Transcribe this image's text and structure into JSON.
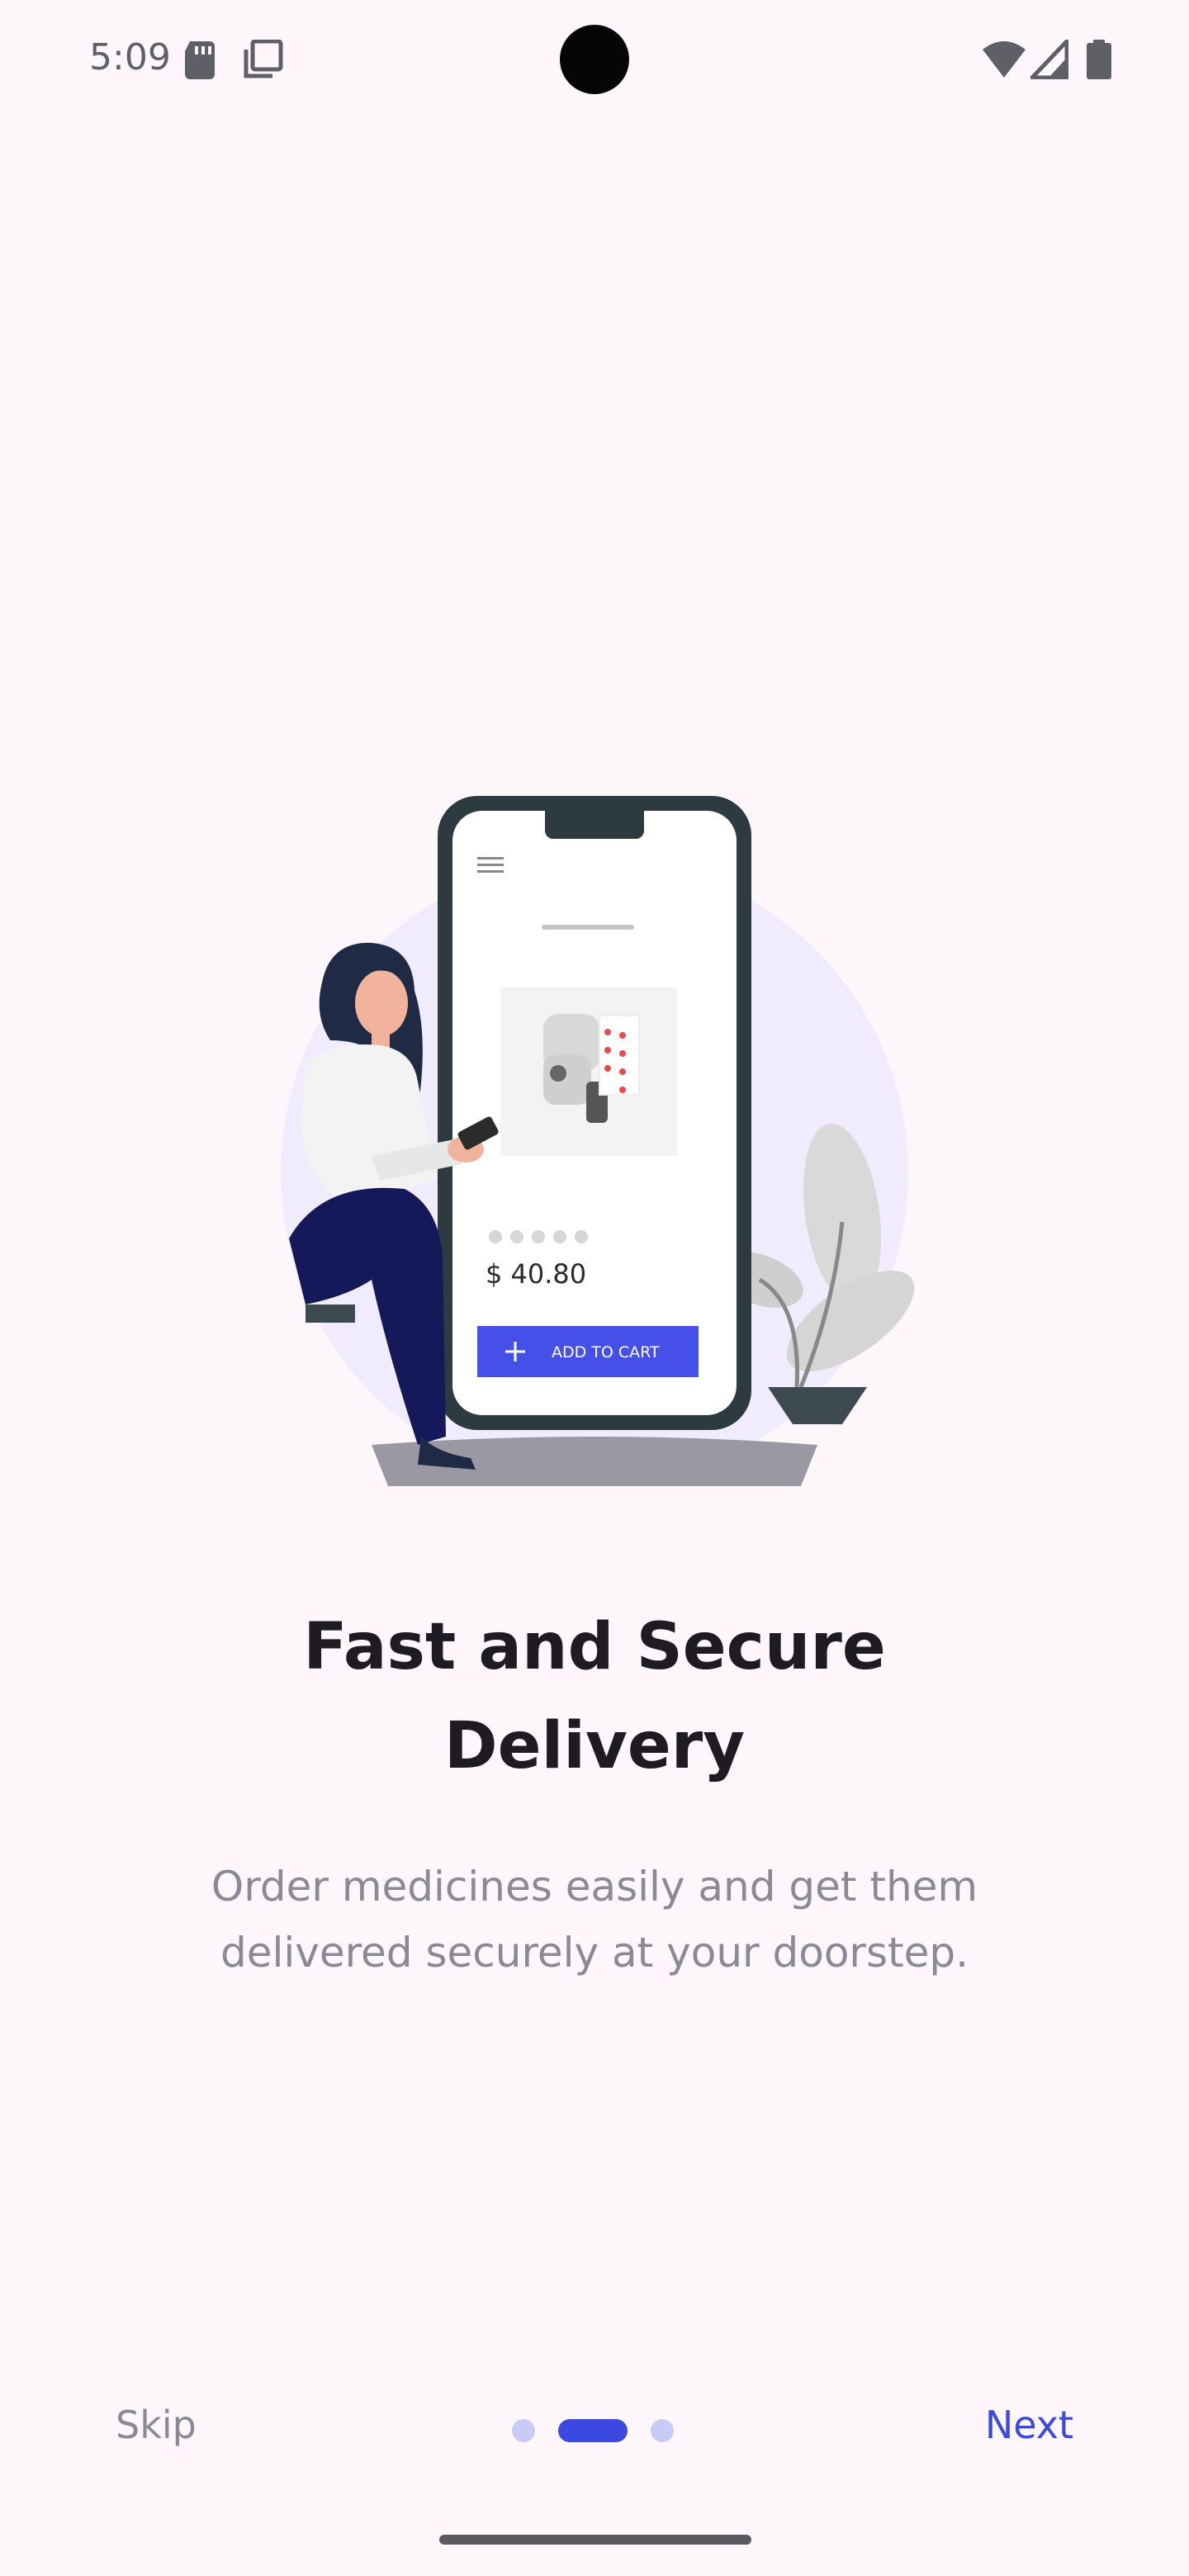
{
  "status_bar": {
    "time": "5:09",
    "left_icons": [
      "sd-card-icon",
      "screen-copy-icon"
    ],
    "right_icons": [
      "wifi-icon",
      "cell-signal-icon",
      "battery-icon"
    ]
  },
  "illustration": {
    "icon": "woman-with-phone-illustration",
    "price": "$ 40.80",
    "button_label": "ADD TO CART"
  },
  "onboarding": {
    "title_line1": "Fast and Secure",
    "title_line2": "Delivery",
    "subtitle_line1": "Order medicines easily and get them",
    "subtitle_line2": "delivered securely at your doorstep."
  },
  "nav": {
    "skip_label": "Skip",
    "next_label": "Next",
    "page_count": 3,
    "current_page": 2
  },
  "colors": {
    "background": "#fdf7fc",
    "accent": "#3b49e0",
    "title": "#1e1b22",
    "muted": "#8a8996",
    "dot_inactive": "#c8cbf5"
  }
}
